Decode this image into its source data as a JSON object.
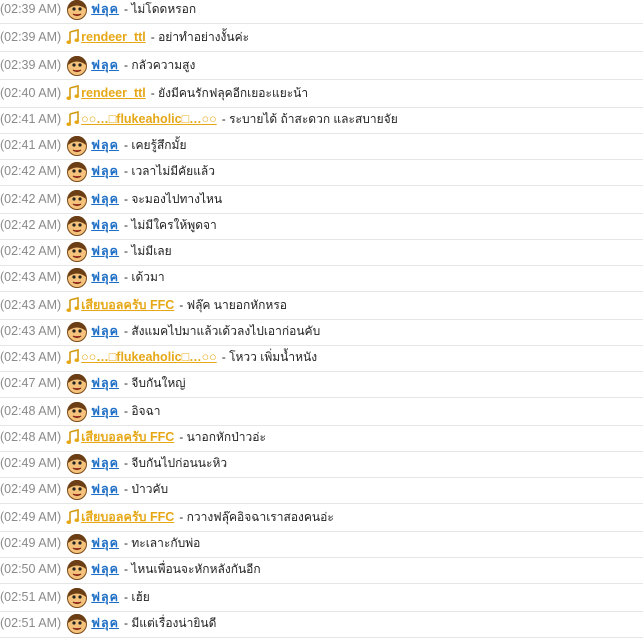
{
  "colors": {
    "user_blue": "#1f6fc5",
    "user_gold": "#e6a817",
    "timestamp": "#8a8a8a"
  },
  "icons": {
    "face": "boy-face-emoticon-icon",
    "note": "music-note-icon"
  },
  "messages": [
    {
      "time": "(02:39 AM)",
      "icon": "face",
      "user": "ฟลุค",
      "style": "a",
      "text": "- ไม่โดดหรอก"
    },
    {
      "time": "(02:39 AM)",
      "icon": "note",
      "user": "rendeer_ttl",
      "style": "b",
      "text": "- อย่าทำอย่างงั้นค่ะ"
    },
    {
      "time": "(02:39 AM)",
      "icon": "face",
      "user": "ฟลุค",
      "style": "a",
      "text": "- กลัวความสูง"
    },
    {
      "time": "(02:40 AM)",
      "icon": "note",
      "user": "rendeer_ttl",
      "style": "b",
      "text": "- ยังมีคนรักฟลุคอีกเยอะแยะน้า"
    },
    {
      "time": "(02:41 AM)",
      "icon": "note",
      "user": "○○…□flukeaholic□…○○",
      "style": "b",
      "text": "- ระบายได้ ถ้าสะดวก และสบายจัย"
    },
    {
      "time": "(02:41 AM)",
      "icon": "face",
      "user": "ฟลุค",
      "style": "a",
      "text": "- เคยรู้สึกมั้ย"
    },
    {
      "time": "(02:42 AM)",
      "icon": "face",
      "user": "ฟลุค",
      "style": "a",
      "text": "- เวลาไม่มีคัยแล้ว"
    },
    {
      "time": "(02:42 AM)",
      "icon": "face",
      "user": "ฟลุค",
      "style": "a",
      "text": "- จะมองไปทางไหน"
    },
    {
      "time": "(02:42 AM)",
      "icon": "face",
      "user": "ฟลุค",
      "style": "a",
      "text": "- ไม่มีใครให้พูดจา"
    },
    {
      "time": "(02:42 AM)",
      "icon": "face",
      "user": "ฟลุค",
      "style": "a",
      "text": "- ไม่มีเลย"
    },
    {
      "time": "(02:43 AM)",
      "icon": "face",
      "user": "ฟลุค",
      "style": "a",
      "text": "- เด้วมา"
    },
    {
      "time": "(02:43 AM)",
      "icon": "note",
      "user": "เสียบอลครับ FFC",
      "style": "b",
      "text": "- ฟลุ๊ค นายอกหักหรอ"
    },
    {
      "time": "(02:43 AM)",
      "icon": "face",
      "user": "ฟลุค",
      "style": "a",
      "text": "- สังแมคไปมาแล้วเด้วลงไปเอาก่อนคับ"
    },
    {
      "time": "(02:43 AM)",
      "icon": "note",
      "user": "○○…□flukeaholic□…○○",
      "style": "b",
      "text": "- โหวว เพิ่มน้ำหนัง"
    },
    {
      "time": "(02:47 AM)",
      "icon": "face",
      "user": "ฟลุค",
      "style": "a",
      "text": "- จีบกันใหญ่"
    },
    {
      "time": "(02:48 AM)",
      "icon": "face",
      "user": "ฟลุค",
      "style": "a",
      "text": "- อิจฉา"
    },
    {
      "time": "(02:48 AM)",
      "icon": "note",
      "user": "เสียบอลครับ FFC",
      "style": "b",
      "text": "- นาอกหักป่าวอ่ะ"
    },
    {
      "time": "(02:49 AM)",
      "icon": "face",
      "user": "ฟลุค",
      "style": "a",
      "text": "- จีบกันไปก่อนนะหิว"
    },
    {
      "time": "(02:49 AM)",
      "icon": "face",
      "user": "ฟลุค",
      "style": "a",
      "text": "- ป่าวคับ"
    },
    {
      "time": "(02:49 AM)",
      "icon": "note",
      "user": "เสียบอลครับ FFC",
      "style": "b",
      "text": "- กวางฟลุ๊คอิจฉาเราสองคนอ่ะ"
    },
    {
      "time": "(02:49 AM)",
      "icon": "face",
      "user": "ฟลุค",
      "style": "a",
      "text": "- ทะเลาะกับพ่อ"
    },
    {
      "time": "(02:50 AM)",
      "icon": "face",
      "user": "ฟลุค",
      "style": "a",
      "text": "- ไหนเพื่อนจะหักหลังกันอีก"
    },
    {
      "time": "(02:51 AM)",
      "icon": "face",
      "user": "ฟลุค",
      "style": "a",
      "text": "- เฮ้ย"
    },
    {
      "time": "(02:51 AM)",
      "icon": "face",
      "user": "ฟลุค",
      "style": "a",
      "text": "- มีแต่เรื่องน่ายินดี"
    }
  ]
}
